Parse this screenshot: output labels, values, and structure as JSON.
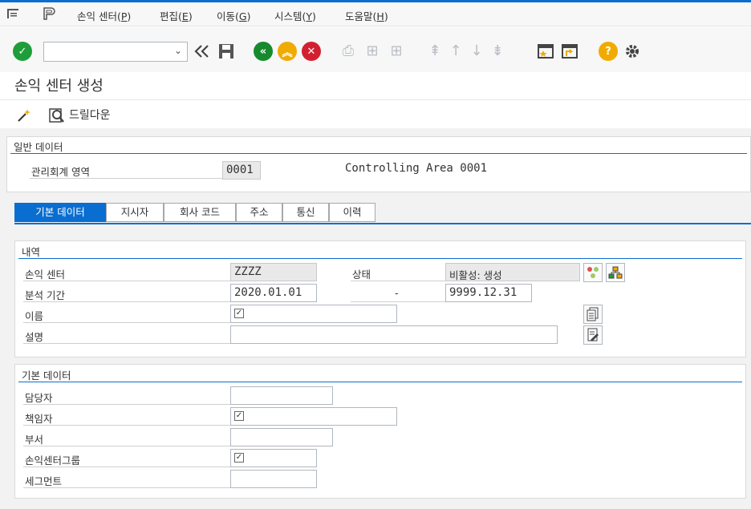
{
  "menu": {
    "items": [
      {
        "label": "손익 센터",
        "key": "P"
      },
      {
        "label": "편집",
        "key": "E"
      },
      {
        "label": "이동",
        "key": "G"
      },
      {
        "label": "시스템",
        "key": "Y"
      },
      {
        "label": "도움말",
        "key": "H"
      }
    ]
  },
  "toolbar": {
    "command_field_value": "",
    "dropdown_caret": "⌄"
  },
  "page": {
    "title": "손익 센터 생성",
    "drilldown_label": "드릴다운"
  },
  "general": {
    "section_title": "일반 데이터",
    "co_area_label": "관리회계 영역",
    "co_area_value": "0001",
    "co_area_desc": "Controlling Area 0001"
  },
  "tabs": [
    {
      "label": "기본 데이터",
      "active": true
    },
    {
      "label": "지시자",
      "active": false
    },
    {
      "label": "회사 코드",
      "active": false
    },
    {
      "label": "주소",
      "active": false
    },
    {
      "label": "통신",
      "active": false
    },
    {
      "label": "이력",
      "active": false
    }
  ],
  "details": {
    "section_title": "내역",
    "profit_center_label": "손익 센터",
    "profit_center_value": "ZZZZ",
    "status_label": "상태",
    "status_value": "비활성: 생성",
    "period_label": "분석 기간",
    "period_from": "2020.01.01",
    "period_sep": "-",
    "period_to": "9999.12.31",
    "name_label": "이름",
    "description_label": "설명"
  },
  "basic": {
    "section_title": "기본 데이터",
    "person_in_charge_label": "담당자",
    "responsible_label": "책임자",
    "department_label": "부서",
    "pc_group_label": "손익센터그룹",
    "segment_label": "세그먼트"
  },
  "colors": {
    "accent": "#0a6ed1",
    "ok_green": "#1e9e3a",
    "back_green": "#188a2e",
    "exit_orange": "#f0ab00",
    "cancel_red": "#d32030",
    "help_yellow": "#f0ab00"
  }
}
